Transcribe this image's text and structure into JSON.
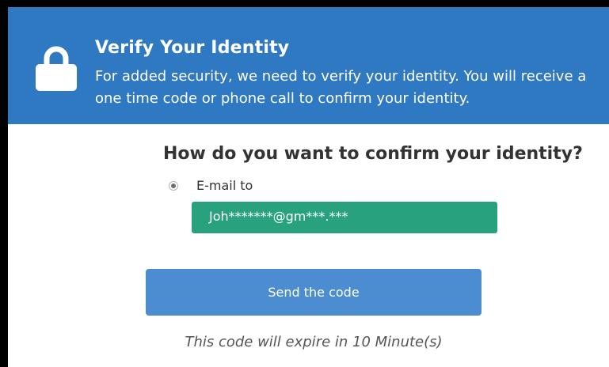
{
  "header": {
    "title": "Verify Your Identity",
    "description": "For added security, we need to verify your identity. You will receive a one time code or phone call to confirm your identity.",
    "icon": "lock-icon",
    "background_color": "#2f78c2"
  },
  "main": {
    "question": "How do you want to confirm your identity?",
    "options": [
      {
        "label": "E-mail to",
        "selected": true,
        "value": "Joh*******@gm***.***"
      }
    ],
    "send_button_label": "Send the code",
    "expiry_note": "This code will expire in 10 Minute(s)"
  },
  "colors": {
    "email_highlight": "#27a17e",
    "button": "#4b8dd0"
  }
}
